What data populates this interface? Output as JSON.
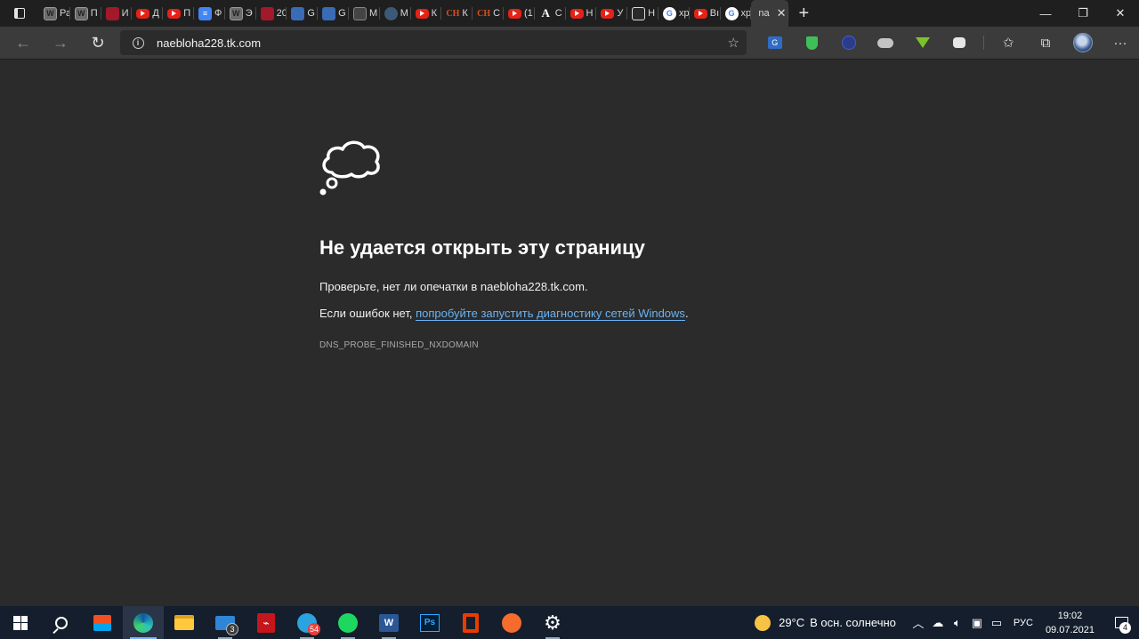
{
  "browser": {
    "tabs": [
      {
        "title": "Ра",
        "favicon": "wiki-icon"
      },
      {
        "title": "П",
        "favicon": "wiki-icon"
      },
      {
        "title": "И",
        "favicon": "red-doc-icon"
      },
      {
        "title": "Д",
        "favicon": "youtube-icon"
      },
      {
        "title": "П",
        "favicon": "youtube-icon"
      },
      {
        "title": "Ф",
        "favicon": "google-docs-icon"
      },
      {
        "title": "Э",
        "favicon": "wiki-icon"
      },
      {
        "title": "20",
        "favicon": "red-logo-icon"
      },
      {
        "title": "G",
        "favicon": "translate-icon"
      },
      {
        "title": "G",
        "favicon": "translate-icon"
      },
      {
        "title": "M",
        "favicon": "dark-doc-icon"
      },
      {
        "title": "M",
        "favicon": "round-icon"
      },
      {
        "title": "К",
        "favicon": "youtube-icon"
      },
      {
        "title": "К",
        "favicon": "ch-icon"
      },
      {
        "title": "С",
        "favicon": "ch-icon"
      },
      {
        "title": "(1",
        "favicon": "youtube-icon"
      },
      {
        "title": "С",
        "favicon": "serif-a-icon"
      },
      {
        "title": "Н",
        "favicon": "youtube-icon"
      },
      {
        "title": "У",
        "favicon": "youtube-icon"
      },
      {
        "title": "Н",
        "favicon": "gamepad-icon"
      },
      {
        "title": "хр",
        "favicon": "google-icon"
      },
      {
        "title": "Вı",
        "favicon": "youtube-icon"
      },
      {
        "title": "хр",
        "favicon": "google-icon"
      }
    ],
    "active_tab": {
      "title": "na"
    },
    "address": "naebloha228.tk.com"
  },
  "error_page": {
    "title": "Не удается открыть эту страницу",
    "line1": "Проверьте, нет ли опечатки в naebloha228.tk.com.",
    "line2_prefix": "Если ошибок нет, ",
    "line2_link": "попробуйте запустить диагностику сетей Windows",
    "line2_suffix": ".",
    "error_code": "DNS_PROBE_FINISHED_NXDOMAIN"
  },
  "taskbar": {
    "mail_badge": "3",
    "telegram_badge": "54",
    "weather_temp": "29°C",
    "weather_text": "В осн. солнечно",
    "language": "РУС",
    "time": "19:02",
    "date": "09.07.2021",
    "notifications": "4"
  },
  "colors": {
    "page_bg": "#2b2b2b",
    "toolbar_bg": "#3b3b3b",
    "link": "#6ab3f5",
    "taskbar_bg": "#141e2c"
  }
}
